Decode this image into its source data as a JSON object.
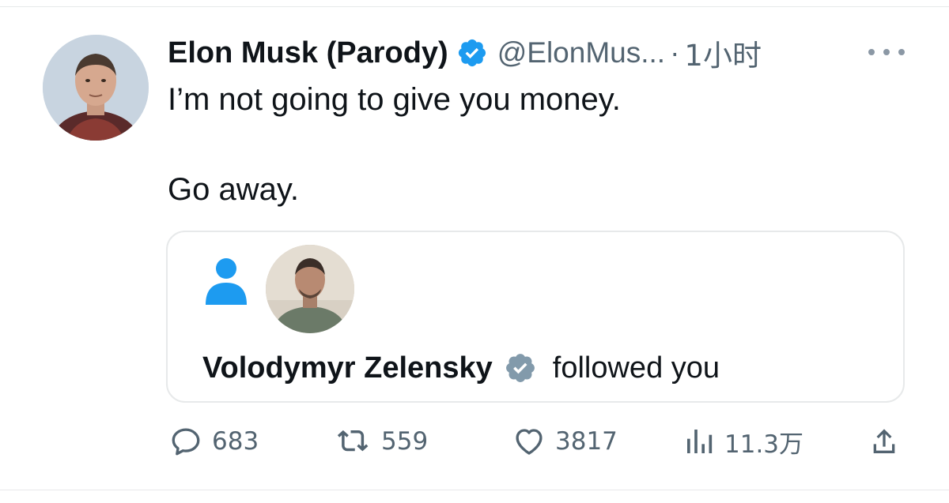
{
  "tweet": {
    "author": {
      "display_name": "Elon Musk (Parody)",
      "verified": true,
      "handle": "@ElonMus...",
      "separator": "·",
      "time": "1小时",
      "avatar": "elon-avatar"
    },
    "text_lines": [
      "I’m not going to give you money.",
      "Go away."
    ],
    "more_icon": "more-horizontal-icon"
  },
  "card": {
    "icons": [
      "person-icon",
      "zelensky-avatar"
    ],
    "name": "Volodymyr Zelensky",
    "verified": true,
    "action_text": "followed you"
  },
  "actions": {
    "reply": {
      "icon": "reply-icon",
      "count": "683"
    },
    "retweet": {
      "icon": "retweet-icon",
      "count": "559"
    },
    "like": {
      "icon": "heart-icon",
      "count": "3817"
    },
    "views": {
      "icon": "views-icon",
      "count": "11.3万"
    },
    "share": {
      "icon": "share-icon"
    }
  },
  "colors": {
    "verified_blue": "#1d9bf0",
    "verified_gray": "#829aab",
    "muted_text": "#536471",
    "text": "#0f1419",
    "border": "#e7e9ea"
  }
}
